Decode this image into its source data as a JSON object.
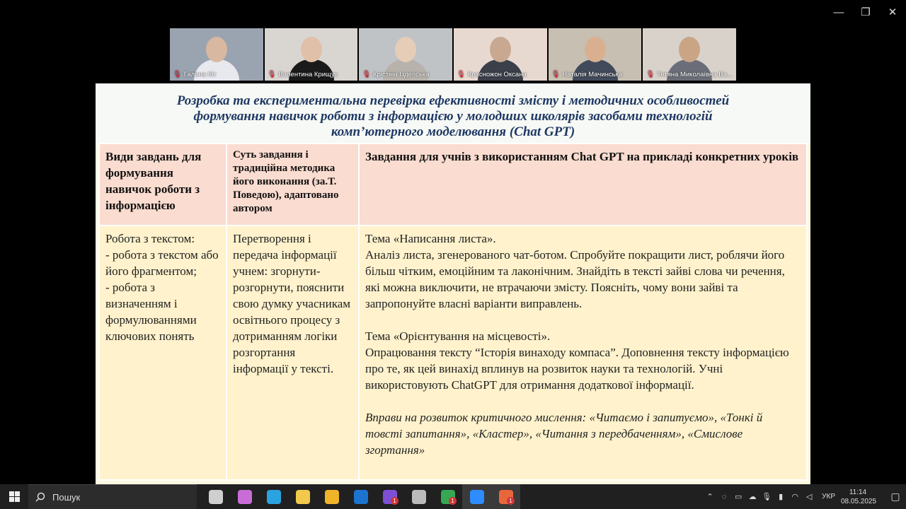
{
  "window_controls": {
    "minimize": "—",
    "restore": "❐",
    "close": "✕"
  },
  "participants": [
    {
      "name": "Галина Кіт",
      "bg": "#9aa3b0",
      "face": "#d8b8a0",
      "body": "#e8e8ef"
    },
    {
      "name": "Валентина Крищук",
      "bg": "#d9d6d2",
      "face": "#e0c0a8",
      "body": "#1a1a1a"
    },
    {
      "name": "Крістіна Іздепська",
      "bg": "#bfc3c6",
      "face": "#e6cdb8",
      "body": "#b7b2ac"
    },
    {
      "name": "Красножон Оксана",
      "bg": "#e8d9d0",
      "face": "#c8a890",
      "body": "#3a3f4a"
    },
    {
      "name": "Наталія Мачинська",
      "bg": "#c6bfb2",
      "face": "#d9b08f",
      "body": "#404a5a"
    },
    {
      "name": "Тетяна Миколаївна Ва...",
      "bg": "#d8d2cb",
      "face": "#c9a586",
      "body": "#6b6e78"
    }
  ],
  "slide": {
    "title_l1": "Розробка та експериментальна перевірка ефективності змісту і методичних особливостей",
    "title_l2": "формування навичок роботи з інформацією у молодших школярів засобами технологій",
    "title_l3": "комп’ютерного моделювання (Chat GPT)",
    "headers": {
      "col1": "Види завдань для формування навичок роботи з інформацією",
      "col2": "Суть завдання і традиційна методика його виконання (за.Т. Поведою), адаптовано автором",
      "col3": "Завдання для учнів з використанням Chat GPT на прикладі конкретних уроків"
    },
    "row": {
      "col1": "Робота з текстом:\n- робота з текстом або його фрагментом;\n- робота з визначенням і формулюваннями ключових понять",
      "col2": "Перетворення і передача інформації учнем: згорнути-розгорнути, пояснити свою думку учасникам освітнього процесу з дотриманням логіки розгортання інформації у тексті.",
      "col3_p1": "Тема «Написання листа».\nАналіз листа, згенерованого чат-ботом. Спробуйте покращити лист, роблячи його більш чітким, емоційним та лаконічним. Знайдіть в тексті зайві слова чи речення, які можна виключити, не втрачаючи змісту. Поясніть, чому вони зайві та запропонуйте власні варіанти виправлень.",
      "col3_p2": "Тема «Орієнтування на місцевості».\nОпрацювання тексту “Історія винаходу компаса”. Доповнення тексту інформацією про те, як цей винахід вплинув на розвиток науки та технологій. Учні використовують ChatGPT для отримання додаткової інформації.",
      "col3_p3": "Вправи на розвиток критичного мислення: «Читаємо і запитуємо», «Тонкі й товсті запитання», «Кластер», «Читання з передбаченням», «Смислове згортання»"
    }
  },
  "taskbar": {
    "search_placeholder": "Пошук",
    "apps": [
      {
        "name": "task-view",
        "color": "#cfcfcf"
      },
      {
        "name": "copilot",
        "color": "#c86dd7"
      },
      {
        "name": "edge",
        "color": "#2aa3e0"
      },
      {
        "name": "store",
        "color": "#f2c94c"
      },
      {
        "name": "file-explorer",
        "color": "#f0b429"
      },
      {
        "name": "outlook",
        "color": "#1b75d0"
      },
      {
        "name": "viber",
        "color": "#7d4fd6",
        "badge": "1"
      },
      {
        "name": "settings",
        "color": "#bbbbbb"
      },
      {
        "name": "chrome",
        "color": "#34a853",
        "badge": "1"
      },
      {
        "name": "zoom",
        "color": "#2d8cff",
        "active": true
      },
      {
        "name": "telegram",
        "color": "#e8673a",
        "badge": "1",
        "active": true
      }
    ],
    "lang": "УКР",
    "time": "11:14",
    "date": "08.05.2025"
  }
}
